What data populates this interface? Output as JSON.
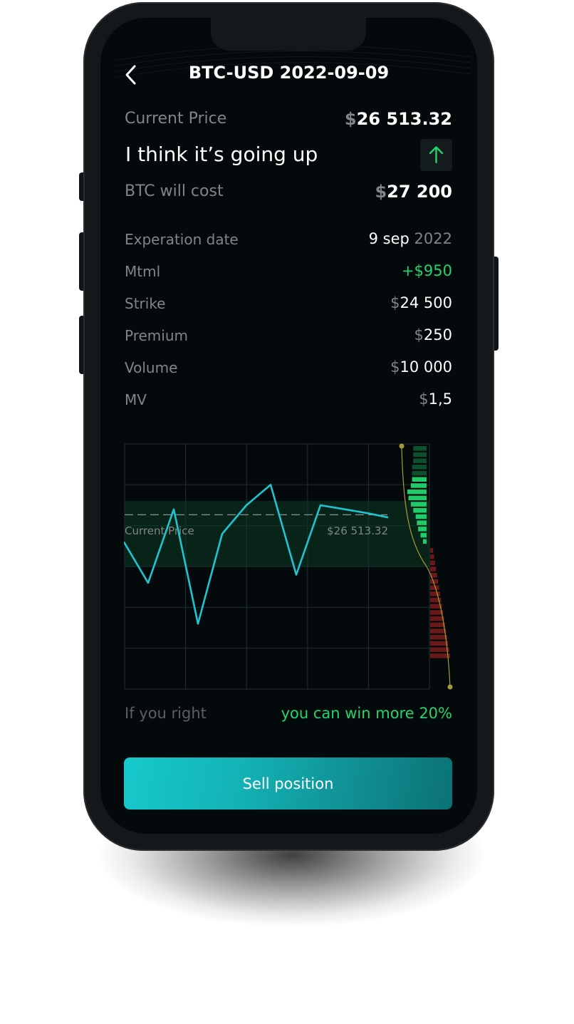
{
  "header": {
    "title": "BTC-USD 2022-09-09",
    "back_icon": "chevron-left-icon"
  },
  "current_price": {
    "label": "Current Price",
    "symbol": "$",
    "amount": "26 513.32"
  },
  "prediction": {
    "text": "I think it’s going up",
    "icon": "arrow-up-icon",
    "accent": "#22d56f"
  },
  "btc_cost": {
    "label": "BTC will cost",
    "symbol": "$",
    "amount": "27 200"
  },
  "details": {
    "expiration": {
      "label": "Experation date",
      "day_month": "9 sep",
      "year": "2022"
    },
    "mtml": {
      "label": "Mtml",
      "value": "+$950",
      "color": "#22d56f"
    },
    "strike": {
      "label": "Strike",
      "symbol": "$",
      "amount": "24 500"
    },
    "premium": {
      "label": "Premium",
      "symbol": "$",
      "amount": "250"
    },
    "volume": {
      "label": "Volume",
      "symbol": "$",
      "amount": "10 000"
    },
    "mv": {
      "label": "MV",
      "symbol": "$",
      "amount": "1,5"
    }
  },
  "chart_data": {
    "type": "line",
    "current_price_label": "Current Price",
    "current_price_value_label": "$26 513.32",
    "x": [
      0,
      1,
      2,
      3,
      4,
      5,
      6,
      7,
      8,
      9,
      10,
      11
    ],
    "values": [
      26480,
      26430,
      26520,
      26380,
      26490,
      26525,
      26550,
      26440,
      26525,
      26520,
      26515,
      26510
    ],
    "ylim": [
      26300,
      26600
    ],
    "current_price": 26513.32,
    "grid": true,
    "line_color": "#20c4d0",
    "depth": {
      "above": [
        0.55,
        0.55,
        0.55,
        0.6,
        0.6,
        0.6,
        0.65,
        0.8,
        0.75,
        0.65,
        0.55,
        0.45,
        0.4,
        0.35,
        0.25,
        0.15
      ],
      "below": [
        0.15,
        0.2,
        0.25,
        0.3,
        0.35,
        0.4,
        0.45,
        0.5,
        0.55,
        0.6,
        0.65,
        0.7,
        0.75,
        0.8,
        0.85,
        0.9,
        0.95,
        1.0
      ],
      "above_color": "#22d56f",
      "below_color": "#7a1c1c"
    }
  },
  "footer": {
    "label": "If you right",
    "message": "you can win more 20%",
    "message_color": "#22d56f"
  },
  "action": {
    "sell_label": "Sell position"
  }
}
